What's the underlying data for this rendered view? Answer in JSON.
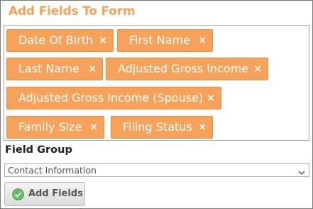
{
  "header": {
    "title": "Add Fields To Form"
  },
  "selected_fields": [
    {
      "label": "Date Of Birth",
      "remove": "×"
    },
    {
      "label": "First Name",
      "remove": "×"
    },
    {
      "label": "Last Name",
      "remove": "×"
    },
    {
      "label": "Adjusted Gross Income",
      "remove": "×"
    },
    {
      "label": "Adjusted Gross Income (Spouse)",
      "remove": "×"
    },
    {
      "label": "Family Size",
      "remove": "×"
    },
    {
      "label": "Filing Status",
      "remove": "×"
    }
  ],
  "field_group": {
    "label": "Field Group",
    "selected": "Contact Information"
  },
  "actions": {
    "add_fields_label": "Add Fields"
  },
  "colors": {
    "accent": "#f7a25a",
    "check_green": "#4caf50"
  },
  "icons": {
    "remove": "close-icon",
    "dropdown": "chevron-down-icon",
    "add": "check-circle-icon"
  }
}
